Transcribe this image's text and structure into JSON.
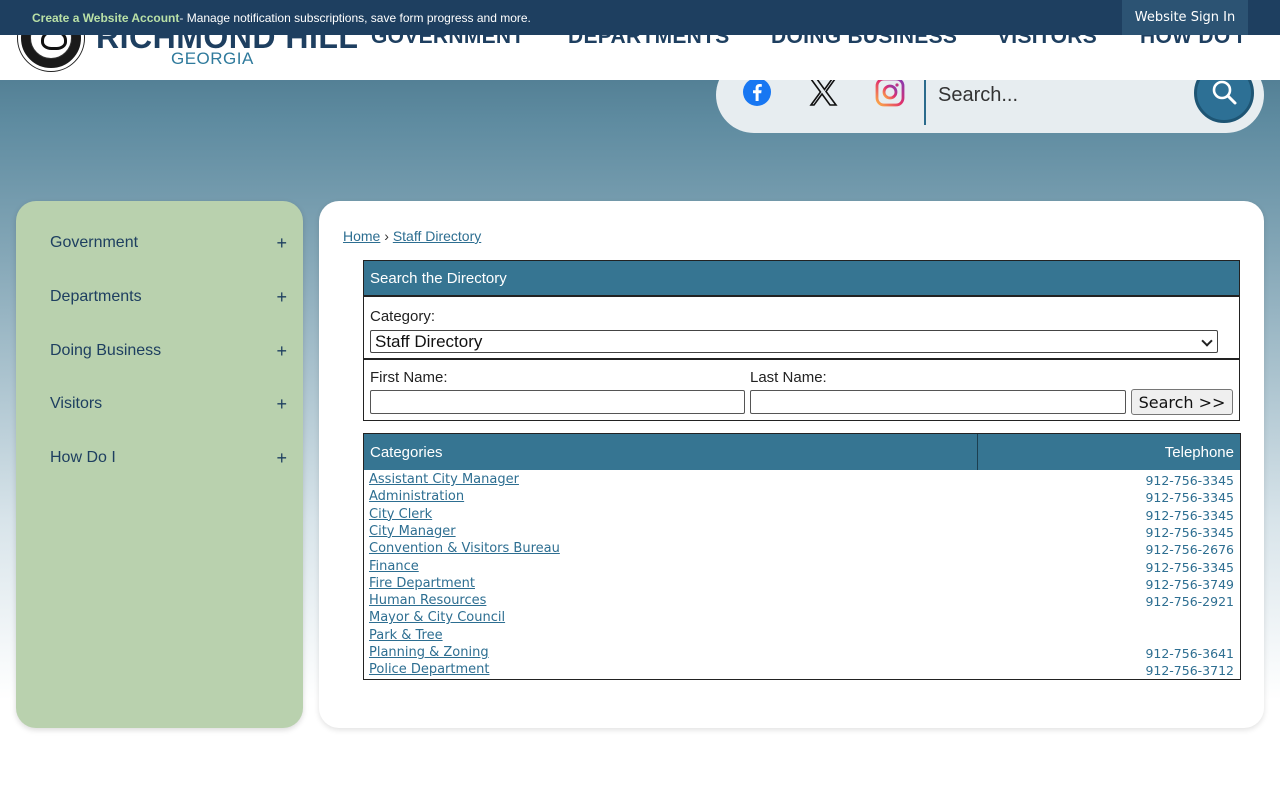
{
  "topbar": {
    "create_link": "Create a Website Account",
    "message": " - Manage notification subscriptions, save form progress and more.",
    "signin": "Website Sign In"
  },
  "header": {
    "brand_name": "RICHMOND HILL",
    "brand_sub": "GEORGIA",
    "nav": [
      "GOVERNMENT",
      "DEPARTMENTS",
      "DOING BUSINESS",
      "VISITORS",
      "HOW DO I"
    ]
  },
  "search": {
    "placeholder": "Search...",
    "social": [
      "facebook-icon",
      "x-icon",
      "instagram-icon"
    ]
  },
  "sidebar": {
    "items": [
      {
        "label": "Government",
        "expand": "+"
      },
      {
        "label": "Departments",
        "expand": "+"
      },
      {
        "label": "Doing Business",
        "expand": "+"
      },
      {
        "label": "Visitors",
        "expand": "+"
      },
      {
        "label": "How Do I",
        "expand": "+"
      }
    ]
  },
  "breadcrumb": {
    "home": "Home",
    "sep": "›",
    "current": "Staff Directory"
  },
  "directory": {
    "title": "Search the Directory",
    "category_label": "Category:",
    "category_value": "Staff Directory",
    "first_name_label": "First Name:",
    "last_name_label": "Last Name:",
    "search_button": "Search >>"
  },
  "categories": {
    "header_name": "Categories",
    "header_tel": "Telephone",
    "rows": [
      {
        "name": "Assistant City Manager",
        "tel": "912-756-3345"
      },
      {
        "name": "Administration",
        "tel": "912-756-3345"
      },
      {
        "name": "City Clerk",
        "tel": "912-756-3345"
      },
      {
        "name": "City Manager",
        "tel": "912-756-3345"
      },
      {
        "name": "Convention & Visitors Bureau",
        "tel": "912-756-2676"
      },
      {
        "name": "Finance",
        "tel": "912-756-3345"
      },
      {
        "name": "Fire Department",
        "tel": "912-756-3749"
      },
      {
        "name": "Human Resources",
        "tel": "912-756-2921"
      },
      {
        "name": "Mayor & City Council",
        "tel": ""
      },
      {
        "name": "Park & Tree",
        "tel": ""
      },
      {
        "name": "Planning & Zoning",
        "tel": "912-756-3641"
      },
      {
        "name": "Police Department",
        "tel": "912-756-3712"
      }
    ]
  },
  "colors": {
    "topbar": "#1e3f60",
    "accent": "#367592",
    "sidebar": "#b9d1ae",
    "link": "#2d6e91"
  }
}
